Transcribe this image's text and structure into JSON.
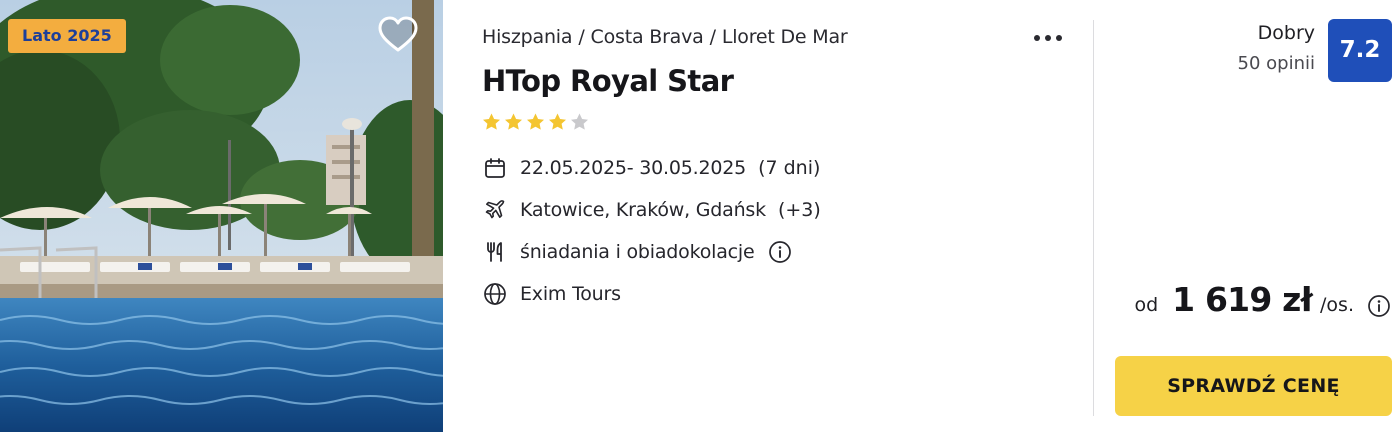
{
  "photo": {
    "season_badge": "Lato 2025",
    "favorite_icon": "heart-outline-icon"
  },
  "hotel": {
    "breadcrumb": [
      "Hiszpania",
      "Costa Brava",
      "Lloret De Mar"
    ],
    "name": "HTop Royal Star",
    "stars": 4,
    "stars_max": 5,
    "more_icon": "more-dots-icon"
  },
  "details": {
    "dates": "22.05.2025- 30.05.2025",
    "duration": "(7 dni)",
    "airports": "Katowice, Kraków, Gdańsk",
    "airports_more": "(+3)",
    "board": "śniadania i obiadokolacje",
    "operator": "Exim Tours"
  },
  "rating": {
    "label": "Dobry",
    "reviews": "50 opinii",
    "score": "7.2"
  },
  "price": {
    "from_label": "od",
    "amount": "1 619 zł",
    "per": "/os."
  },
  "cta": {
    "label": "SPRAWDŹ CENĘ"
  },
  "colors": {
    "badge_bg": "#f3ad3f",
    "badge_text": "#1d3f9a",
    "star_filled": "#f4c531",
    "star_empty": "#c9c9cc",
    "score_bg": "#1f4fb9",
    "cta_bg": "#f6d247"
  }
}
